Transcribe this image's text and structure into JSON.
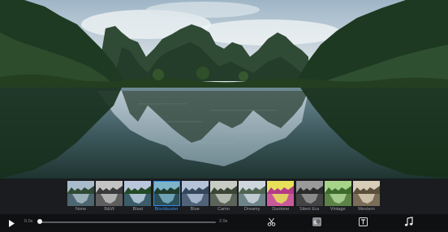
{
  "filters": [
    {
      "label": "None",
      "selected": false
    },
    {
      "label": "B&W",
      "selected": false
    },
    {
      "label": "Blast",
      "selected": false
    },
    {
      "label": "Blockbuster",
      "selected": true
    },
    {
      "label": "Blue",
      "selected": false
    },
    {
      "label": "Camo",
      "selected": false
    },
    {
      "label": "Dreamy",
      "selected": false
    },
    {
      "label": "Duotone",
      "selected": false
    },
    {
      "label": "Silent Era",
      "selected": false
    },
    {
      "label": "Vintage",
      "selected": false
    },
    {
      "label": "Western",
      "selected": false
    }
  ],
  "playback": {
    "current_time": "0.0s",
    "total_time": "2.9s",
    "progress_fraction": 0.0
  },
  "toolbar": {
    "play_icon": "play-icon",
    "effects_icon": "scissors-icon",
    "filters_icon": "filters-icon",
    "titles_icon": "text-title-icon",
    "music_icon": "music-note-icon"
  },
  "colors": {
    "selected_accent": "#2f8cf0",
    "background": "#101214"
  }
}
